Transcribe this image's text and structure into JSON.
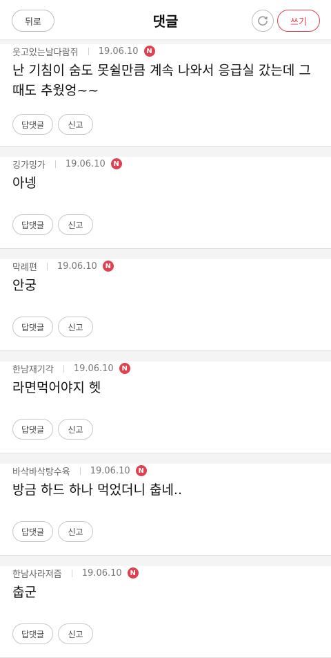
{
  "header": {
    "back_label": "뒤로",
    "title": "댓글",
    "refresh_icon": "refresh-icon",
    "write_label": "쓰기"
  },
  "comments": [
    {
      "author": "웃고있는날다람쥐",
      "date": "19.06.10",
      "badge": "N",
      "text": "난 기침이 숨도 못쉴만큼 계속 나와서 응급실 갔는데 그때도 추웠엉~~",
      "reply_label": "답댓글",
      "report_label": "신고"
    },
    {
      "author": "깅가밍가",
      "date": "19.06.10",
      "badge": "N",
      "text": "아넹",
      "reply_label": "답댓글",
      "report_label": "신고"
    },
    {
      "author": "막례편",
      "date": "19.06.10",
      "badge": "N",
      "text": "안궁",
      "reply_label": "답댓글",
      "report_label": "신고"
    },
    {
      "author": "한남재기각",
      "date": "19.06.10",
      "badge": "N",
      "text": "라면먹어야지 헷",
      "reply_label": "답댓글",
      "report_label": "신고"
    },
    {
      "author": "바삭바삭탕수육",
      "date": "19.06.10",
      "badge": "N",
      "text": "방금 하드 하나 먹었더니 춥네..",
      "reply_label": "답댓글",
      "report_label": "신고"
    },
    {
      "author": "한남사라져즘",
      "date": "19.06.10",
      "badge": "N",
      "text": "춥군",
      "reply_label": "답댓글",
      "report_label": "신고"
    }
  ],
  "colors": {
    "accent": "#e0404f",
    "background": "#f4f4f4"
  }
}
